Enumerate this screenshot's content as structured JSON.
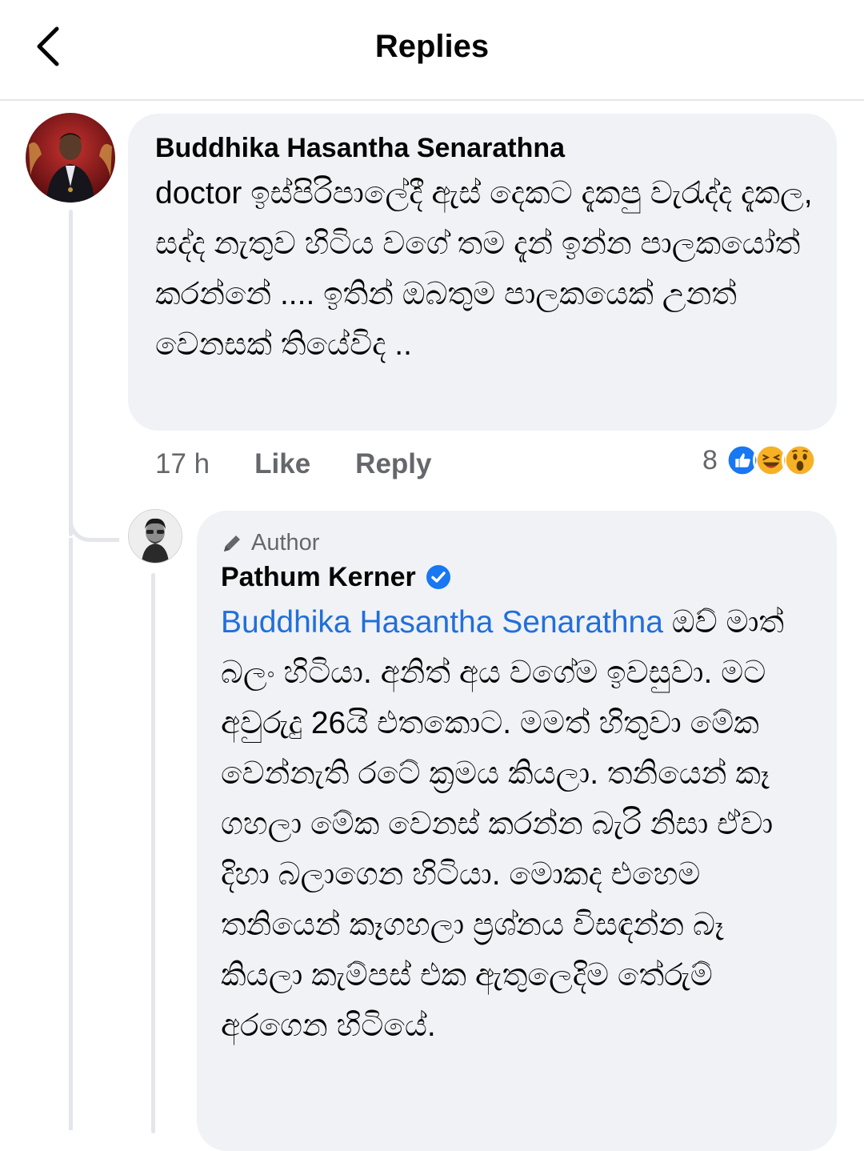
{
  "header": {
    "title": "Replies",
    "back_icon": "chevron-left-icon"
  },
  "comment": {
    "author": "Buddhika Hasantha Senarathna",
    "text": "doctor ඉස්පිරිපාලේදී ඇස් දෙකට දැකපු වැරැද්ද දැකල, සද්ද නැතුව හිටිය වගේ තම දැන් ඉන්න පාලකයෝත් කරන්නේ .... ඉතින් ඔබතුම පාලකයෙක් උනත් වෙනසක් තියේවිද ..",
    "time": "17 h",
    "like_label": "Like",
    "reply_label": "Reply",
    "reaction_count": "8",
    "reactions": [
      "like-reaction-icon",
      "haha-reaction-icon",
      "wow-reaction-icon"
    ]
  },
  "reply": {
    "badge": "Author",
    "badge_icon": "pencil-icon",
    "author": "Pathum Kerner",
    "verified_icon": "verified-badge-icon",
    "mention": "Buddhika Hasantha Senarathna",
    "text": "ඔව් මාත් බලං හිටියා. අනිත් අය වගේම ඉවසුවා. මට අවුරුදු 26යි එතකොට. මමත් හිතුවා මේක වෙන්නැති රටේ ක්‍රමය කියලා. තනියෙන් කෑ ගහලා මේක වෙනස් කරන්න බැරි නිසා ඒවා දිහා බලාගෙන හිටියා. මොකද එහෙම තනියෙන් කෑගහලා ප්‍රශ්නය විසඳන්න බෑ කියලා කැම්පස් එක ඇතුලෙදිම තේරුම් අරගෙන හිටියේ."
  },
  "colors": {
    "mention": "#216fdb",
    "bubble": "#f0f2f5",
    "meta": "#65676b",
    "like_blue": "#1877f2"
  }
}
